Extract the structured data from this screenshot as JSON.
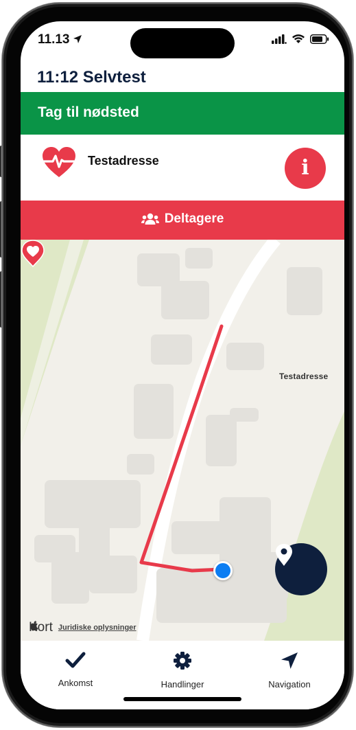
{
  "status_bar": {
    "time": "11.13"
  },
  "header": {
    "title": "11:12 Selvtest"
  },
  "banner": {
    "label": "Tag til nødsted",
    "color": "#0a9447"
  },
  "incident": {
    "address": "Testadresse",
    "info_label": "i",
    "icon": "heart-pulse-icon"
  },
  "participants": {
    "label": "Deltagere",
    "color": "#e83a4a"
  },
  "map": {
    "pin_label": "Testadresse",
    "brand": "Kort",
    "legal_link": "Juridiske oplysninger"
  },
  "tabs": [
    {
      "label": "Ankomst",
      "icon": "checkmark-icon"
    },
    {
      "label": "Handlinger",
      "icon": "gear-icon"
    },
    {
      "label": "Navigation",
      "icon": "navigation-arrow-icon"
    }
  ]
}
